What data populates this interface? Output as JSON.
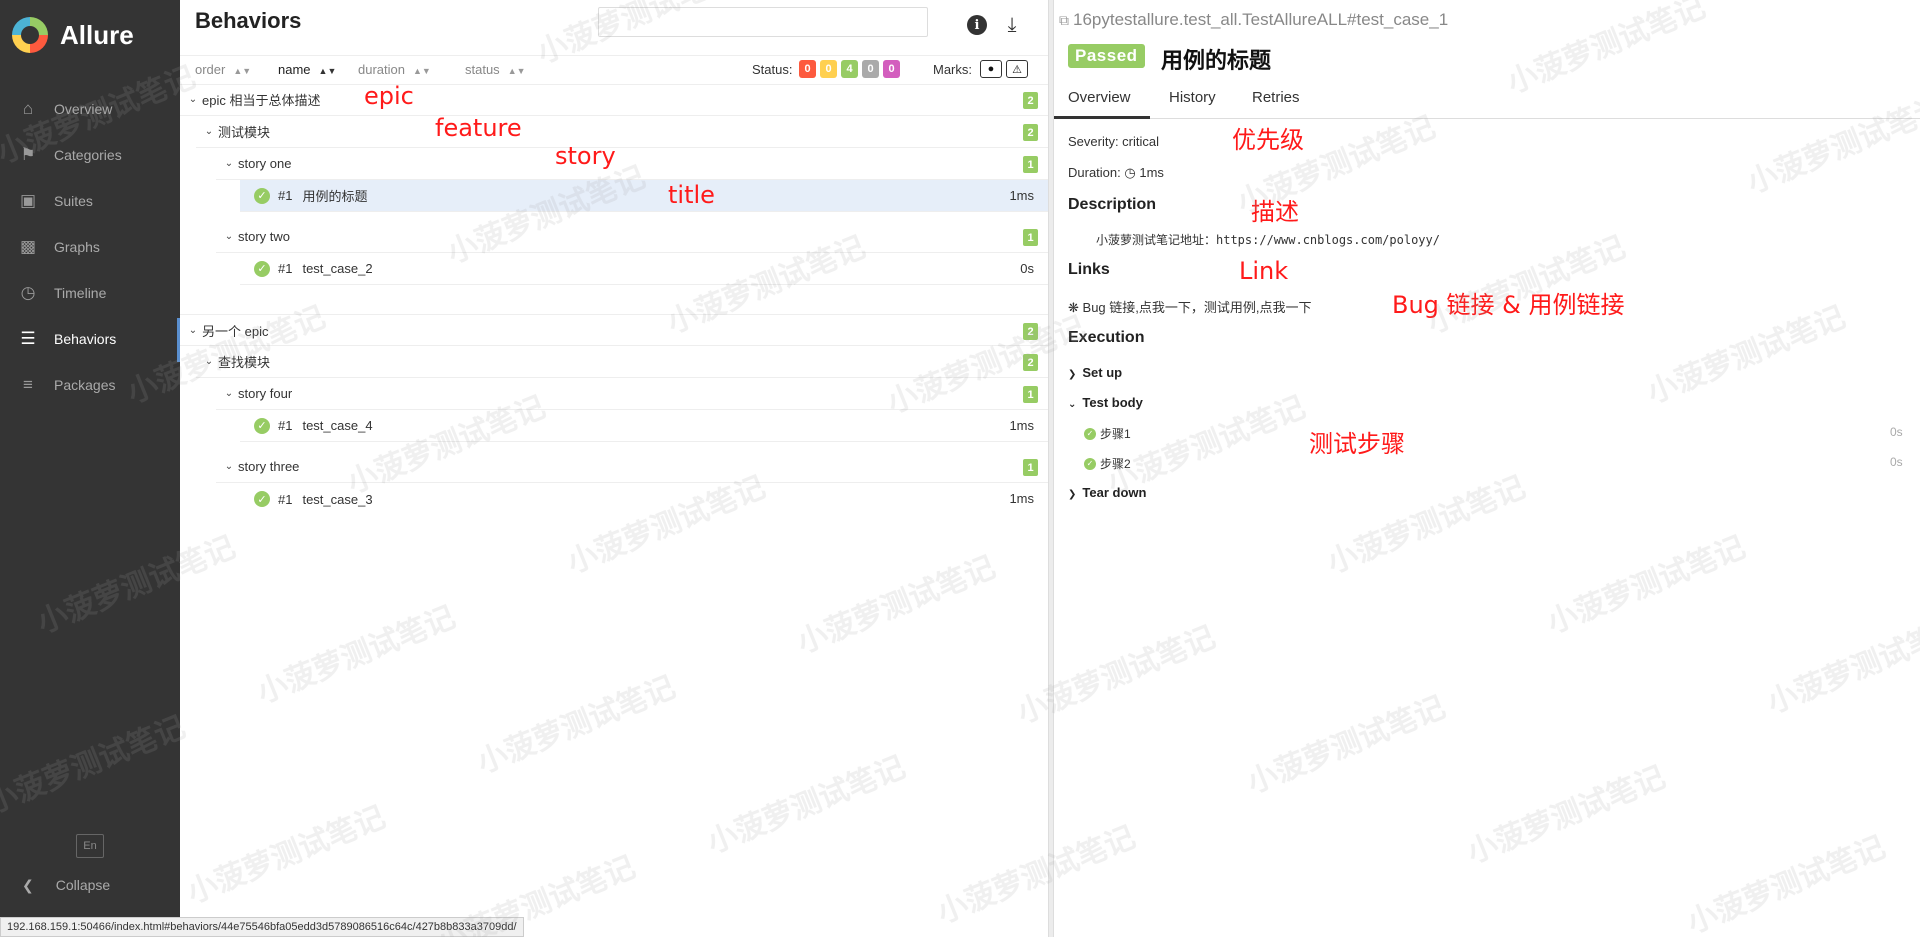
{
  "brand": {
    "name": "Allure"
  },
  "sidebar": {
    "items": [
      {
        "label": "Overview",
        "icon": "home-icon"
      },
      {
        "label": "Categories",
        "icon": "flag-icon"
      },
      {
        "label": "Suites",
        "icon": "briefcase-icon"
      },
      {
        "label": "Graphs",
        "icon": "bar-chart-icon"
      },
      {
        "label": "Timeline",
        "icon": "clock-icon"
      },
      {
        "label": "Behaviors",
        "icon": "list-icon",
        "active": true
      },
      {
        "label": "Packages",
        "icon": "align-left-icon"
      }
    ],
    "language": "En",
    "collapse_label": "Collapse"
  },
  "tree": {
    "title": "Behaviors",
    "columns": {
      "order": "order",
      "name": "name",
      "duration": "duration",
      "status": "status"
    },
    "status_label": "Status:",
    "status_counts": [
      "0",
      "0",
      "4",
      "0",
      "0"
    ],
    "status_colors": [
      "#fd5a3e",
      "#ffd050",
      "#97cc64",
      "#aaaaaa",
      "#d35ebe"
    ],
    "marks_label": "Marks:",
    "rows": [
      {
        "label": "epic 相当于总体描述",
        "count": "2"
      },
      {
        "label": "测试模块",
        "count": "2"
      },
      {
        "label": "story one",
        "count": "1"
      },
      {
        "index": "#1",
        "label": "用例的标题",
        "duration": "1ms"
      },
      {
        "label": "story two",
        "count": "1"
      },
      {
        "index": "#1",
        "label": "test_case_2",
        "duration": "0s"
      },
      {
        "label": "另一个 epic",
        "count": "2"
      },
      {
        "label": "查找模块",
        "count": "2"
      },
      {
        "label": "story four",
        "count": "1"
      },
      {
        "index": "#1",
        "label": "test_case_4",
        "duration": "1ms"
      },
      {
        "label": "story three",
        "count": "1"
      },
      {
        "index": "#1",
        "label": "test_case_3",
        "duration": "1ms"
      }
    ]
  },
  "annotations": {
    "epic": "epic",
    "feature": "feature",
    "story": "story",
    "title": "title",
    "severity": "优先级",
    "description": "描述",
    "link": "Link",
    "links": "Bug 链接 & 用例链接",
    "steps": "测试步骤"
  },
  "detail": {
    "fullname": "16pytestallure.test_all.TestAllureALL#test_case_1",
    "status": "Passed",
    "title": "用例的标题",
    "tabs": [
      "Overview",
      "History",
      "Retries"
    ],
    "severity": "Severity: critical",
    "duration_label": "Duration:",
    "duration_value": "1ms",
    "description_heading": "Description",
    "description_text": "小菠萝测试笔记地址：https://www.cnblogs.com/poloyy/",
    "links_heading": "Links",
    "links_text": "Bug 链接,点我一下，测试用例,点我一下",
    "execution_heading": "Execution",
    "setup": "Set up",
    "test_body": "Test body",
    "steps": [
      {
        "label": "步骤1",
        "duration": "0s"
      },
      {
        "label": "步骤2",
        "duration": "0s"
      }
    ],
    "teardown": "Tear down"
  },
  "statusbar": {
    "url": "192.168.159.1:50466/index.html#behaviors/44e75546bfa05edd3d5789086516c64c/427b8b833a3709dd/"
  },
  "watermark": "小菠萝测试笔记"
}
